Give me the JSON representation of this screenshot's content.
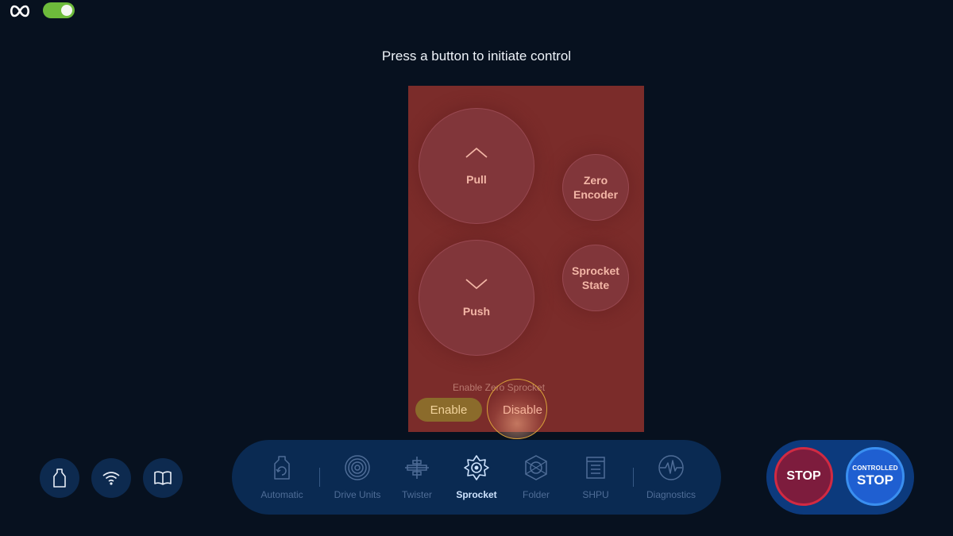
{
  "header": {
    "toggle_on": true,
    "instruction": "Press a button to initiate control"
  },
  "control_panel": {
    "pull_label": "Pull",
    "push_label": "Push",
    "zero_encoder_label": "Zero Encoder",
    "sprocket_state_label": "Sprocket State",
    "enable_zero_label": "Enable Zero Sprocket",
    "enable_label": "Enable",
    "disable_label": "Disable",
    "colors": {
      "panel": "#7b2c2a",
      "enable_pill": "#8b6b2b"
    }
  },
  "side_buttons": [
    {
      "icon": "bottle-icon"
    },
    {
      "icon": "wifi-icon"
    },
    {
      "icon": "book-icon"
    }
  ],
  "nav": {
    "items": [
      {
        "label": "Automatic",
        "icon": "automatic-icon",
        "active": false
      },
      {
        "label": "Drive Units",
        "icon": "drive-units-icon",
        "active": false
      },
      {
        "label": "Twister",
        "icon": "twister-icon",
        "active": false
      },
      {
        "label": "Sprocket",
        "icon": "sprocket-icon",
        "active": true
      },
      {
        "label": "Folder",
        "icon": "folder-icon",
        "active": false
      },
      {
        "label": "SHPU",
        "icon": "shpu-icon",
        "active": false
      },
      {
        "label": "Diagnostics",
        "icon": "diagnostics-icon",
        "active": false
      }
    ]
  },
  "stop_controls": {
    "stop_label": "STOP",
    "controlled_label": "CONTROLLED",
    "controlled_stop_label": "STOP",
    "colors": {
      "stop": "#7d1c3d",
      "controlled_stop": "#1f5fd1"
    }
  }
}
